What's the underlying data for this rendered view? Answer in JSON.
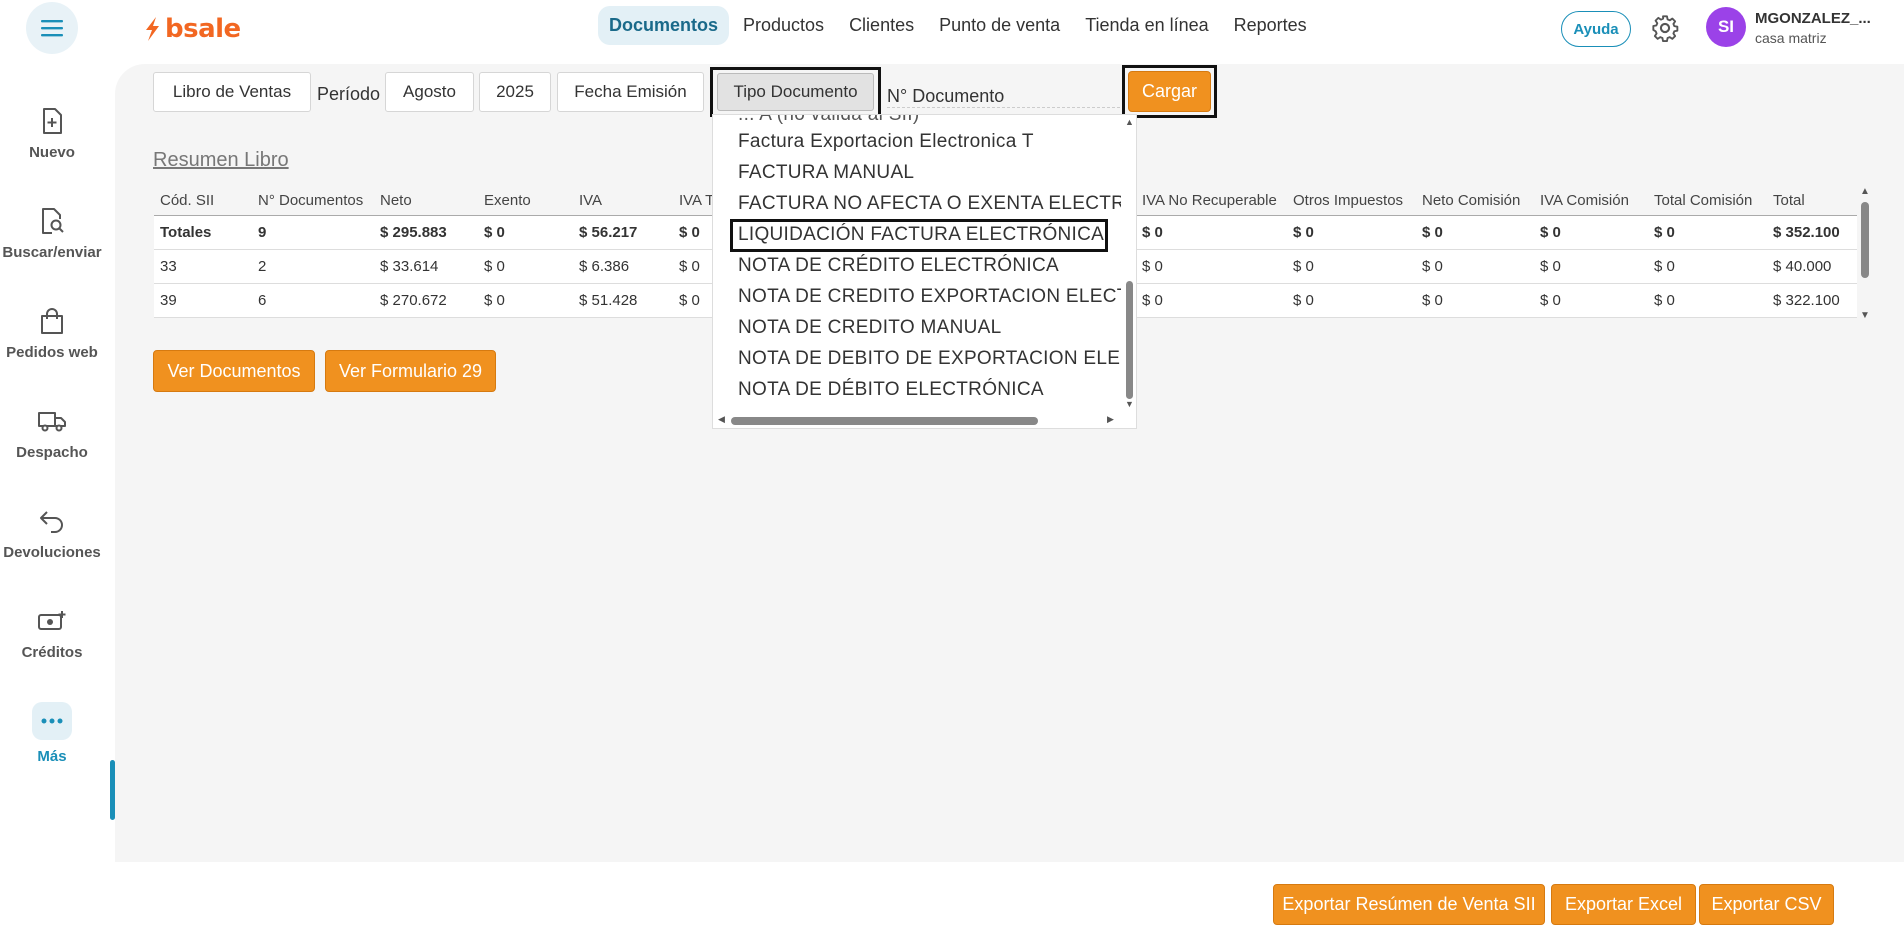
{
  "header": {
    "brand": "bsale",
    "nav": [
      "Documentos",
      "Productos",
      "Clientes",
      "Punto de venta",
      "Tienda en línea",
      "Reportes"
    ],
    "active_nav": "Documentos",
    "help_label": "Ayuda",
    "user": {
      "initials": "SI",
      "name": "MGONZALEZ_...",
      "store": "casa matriz"
    }
  },
  "sidebar": {
    "items": [
      {
        "label": "Nuevo",
        "icon": "new-document-icon"
      },
      {
        "label": "Buscar/enviar",
        "icon": "search-document-icon"
      },
      {
        "label": "Pedidos web",
        "icon": "shopping-bag-icon"
      },
      {
        "label": "Despacho",
        "icon": "truck-icon"
      },
      {
        "label": "Devoluciones",
        "icon": "return-arrow-icon"
      },
      {
        "label": "Créditos",
        "icon": "money-plus-icon"
      },
      {
        "label": "Más",
        "icon": "more-dots-icon"
      }
    ],
    "active": "Más"
  },
  "filters": {
    "libro": "Libro de Ventas",
    "periodo_label": "Período",
    "mes": "Agosto",
    "anio": "2025",
    "fecha": "Fecha Emisión",
    "tipo_documento": "Tipo Documento",
    "n_documento": "N° Documento",
    "cargar": "Cargar"
  },
  "dropdown": {
    "partial_top": "... A (no válida al SII)",
    "options": [
      "Factura Exportacion Electronica T",
      "FACTURA MANUAL",
      "FACTURA NO AFECTA O EXENTA ELECTRÓNICA",
      "LIQUIDACIÓN FACTURA ELECTRÓNICA",
      "NOTA DE CRÉDITO ELECTRÓNICA",
      "NOTA DE CREDITO EXPORTACION ELECTRONICA",
      "NOTA DE CREDITO MANUAL",
      "NOTA DE DEBITO DE EXPORTACION ELECTRONICA",
      "NOTA DE DÉBITO ELECTRÓNICA"
    ],
    "selected": "LIQUIDACIÓN FACTURA ELECTRÓNICA"
  },
  "resumen": {
    "title": "Resumen Libro",
    "columns_left": [
      "Cód. SII",
      "N° Documentos",
      "Neto",
      "Exento",
      "IVA",
      "IVA T"
    ],
    "columns_right": [
      "IVA No Recuperable",
      "Otros Impuestos",
      "Neto Comisión",
      "IVA Comisión",
      "Total Comisión",
      "Total"
    ],
    "rows": [
      {
        "left": [
          "Totales",
          "9",
          "$ 295.883",
          "$ 0",
          "$ 56.217",
          "$ 0"
        ],
        "right": [
          "$ 0",
          "$ 0",
          "$ 0",
          "$ 0",
          "$ 0",
          "$ 352.100"
        ]
      },
      {
        "left": [
          "33",
          "2",
          "$ 33.614",
          "$ 0",
          "$ 6.386",
          "$ 0"
        ],
        "right": [
          "$ 0",
          "$ 0",
          "$ 0",
          "$ 0",
          "$ 0",
          "$ 40.000"
        ]
      },
      {
        "left": [
          "39",
          "6",
          "$ 270.672",
          "$ 0",
          "$ 51.428",
          "$ 0"
        ],
        "right": [
          "$ 0",
          "$ 0",
          "$ 0",
          "$ 0",
          "$ 0",
          "$ 322.100"
        ]
      }
    ]
  },
  "actions": {
    "ver_documentos": "Ver Documentos",
    "ver_formulario": "Ver Formulario 29",
    "exportar_resumen": "Exportar Resúmen de Venta SII",
    "exportar_excel": "Exportar Excel",
    "exportar_csv": "Exportar CSV"
  },
  "colors": {
    "brand": "#f26722",
    "accent": "#1a8fb8",
    "button": "#f0911f",
    "avatar": "#9b42e8"
  }
}
